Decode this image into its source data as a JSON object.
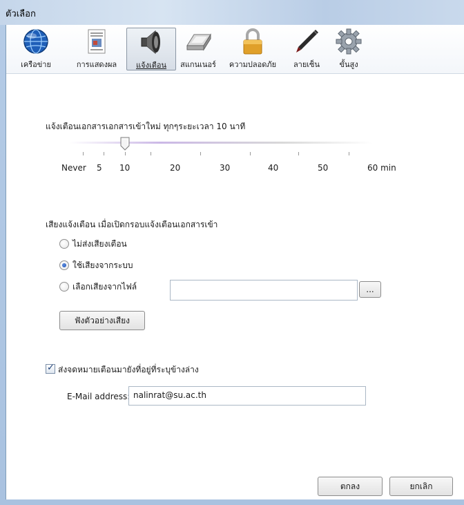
{
  "window": {
    "title": "ตัวเลือก"
  },
  "toolbar": {
    "items": [
      {
        "label": "เครือข่าย",
        "icon": "globe-icon"
      },
      {
        "label": "การแสดงผล",
        "icon": "display-icon"
      },
      {
        "label": "แจ้งเตือน",
        "icon": "speaker-icon",
        "active": true
      },
      {
        "label": "สแกนเนอร์",
        "icon": "scanner-icon"
      },
      {
        "label": "ความปลอดภัย",
        "icon": "lock-icon"
      },
      {
        "label": "ลายเซ็น",
        "icon": "pen-icon"
      },
      {
        "label": "ขั้นสูง",
        "icon": "gear-icon"
      }
    ]
  },
  "interval": {
    "heading": "แจ้งเตือนเอกสารเอกสารเข้าใหม่ ทุกๆระยะเวลา 10 นาที",
    "value_minutes": 10,
    "ticks": {
      "never": "Never",
      "five": "5",
      "ten": "10",
      "twenty": "20",
      "thirty": "30",
      "forty": "40",
      "fifty": "50",
      "sixty": "60 min"
    }
  },
  "sound": {
    "heading": "เสียงแจ้งเตือน เมื่อเปิดกรอบแจ้งเตือนเอกสารเข้า",
    "options": [
      {
        "label": "ไม่ส่งเสียงเตือน",
        "selected": false
      },
      {
        "label": "ใช้เสียงจากระบบ",
        "selected": true
      },
      {
        "label": "เลือกเสียงจากไฟล์",
        "selected": false
      }
    ],
    "file_value": "",
    "browse_label": "...",
    "preview_label": "ฟังตัวอย่างเสียง"
  },
  "email": {
    "checkbox_label": "ส่งจดหมายเตือนมายังที่อยู่ที่ระบุข้างล่าง",
    "checked": true,
    "field_label": "E-Mail address:",
    "field_value": "nalinrat@su.ac.th"
  },
  "footer": {
    "ok_label": "ตกลง",
    "cancel_label": "ยกเลิก"
  }
}
